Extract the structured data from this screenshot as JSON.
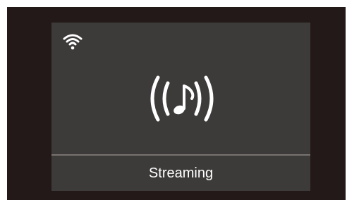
{
  "device_screen": {
    "status_label": "Streaming",
    "wifi_icon": "wifi-icon",
    "center_icon": "music-streaming-icon",
    "colors": {
      "frame": "#221918",
      "screen": "#3d3b3a",
      "divider": "#77726f",
      "foreground": "#ffffff"
    }
  }
}
